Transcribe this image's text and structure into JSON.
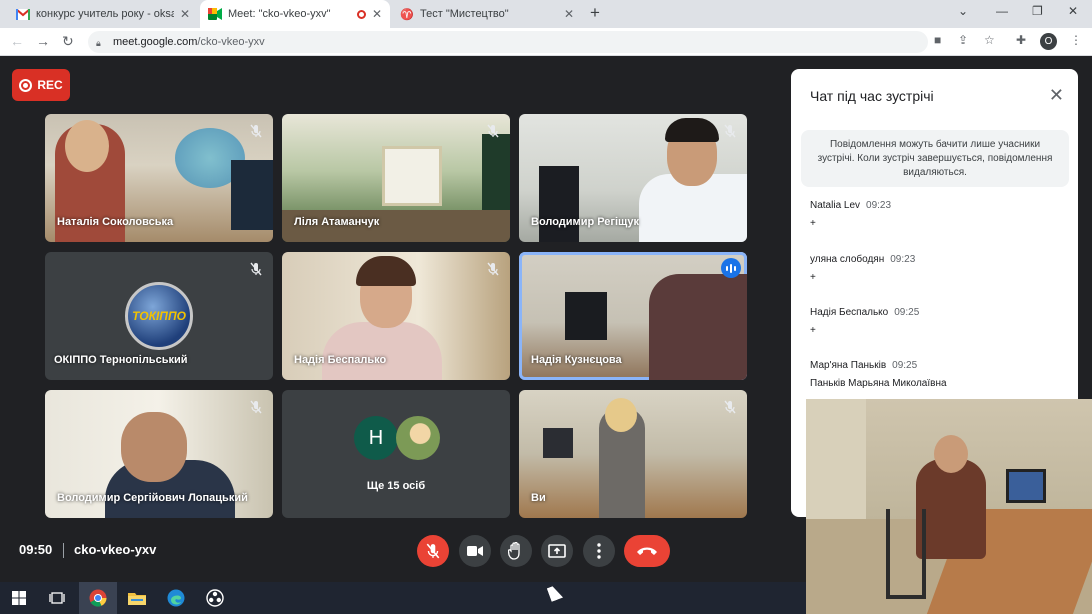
{
  "browser": {
    "tabs": [
      {
        "label": "конкурс учитель року - oksana.c",
        "favicon": "gmail-icon",
        "active": false
      },
      {
        "label": "Meet: \"cko-vkeo-yxv\"",
        "favicon": "meet-icon",
        "active": true,
        "recording": true
      },
      {
        "label": "Тест \"Мистецтво\"",
        "favicon": "test-icon",
        "active": false
      }
    ],
    "url_host": "meet.google.com",
    "url_path": "/cko-vkeo-yxv",
    "profile_initial": "O"
  },
  "meet": {
    "rec_label": "REC",
    "participants": [
      {
        "name": "Наталія Соколовська",
        "muted": true,
        "scene": "classroom-mural"
      },
      {
        "name": "Ліля Атаманчук",
        "muted": true,
        "scene": "classroom-green"
      },
      {
        "name": "Володимир Регіщук",
        "muted": true,
        "scene": "man-desk"
      },
      {
        "name": "ОКІППО Тернопільський",
        "muted": true,
        "scene": "logo",
        "logo_text": "ТОКІППО"
      },
      {
        "name": "Надія Беспалько",
        "muted": true,
        "scene": "woman-close"
      },
      {
        "name": "Надія Кузнєцова",
        "muted": false,
        "speaking": true,
        "scene": "computer-lab"
      },
      {
        "name": "Володимир Сергійович Лопацький",
        "muted": true,
        "scene": "man-window"
      },
      {
        "name": "Ще 15 осіб",
        "muted": false,
        "scene": "more",
        "avatar_letter": "Н"
      },
      {
        "name": "Ви",
        "muted": true,
        "scene": "you-desk"
      }
    ],
    "clock": "09:50",
    "meeting_code": "cko-vkeo-yxv",
    "controls": [
      "mic-off-icon",
      "camera-icon",
      "raise-hand-icon",
      "present-icon",
      "more-icon",
      "end-call-icon"
    ]
  },
  "chat": {
    "title": "Чат під час зустрічі",
    "notice": "Повідомлення можуть бачити лише учасники зустрічі. Коли зустріч завершується, повідомлення видаляються.",
    "messages": [
      {
        "author": "Natalia Lev",
        "time": "09:23",
        "text": "+"
      },
      {
        "author": "уляна слободян",
        "time": "09:23",
        "text": "+"
      },
      {
        "author": "Надія Беспалько",
        "time": "09:25",
        "text": "+"
      },
      {
        "author": "Мар'яна Паньків",
        "time": "09:25",
        "text": "Паньків Марьяна Миколаївна"
      }
    ]
  },
  "taskbar": {
    "items": [
      "windows-start-icon",
      "task-view-icon",
      "chrome-icon",
      "file-explorer-icon",
      "edge-icon",
      "obs-icon"
    ]
  },
  "colors": {
    "meet_bg": "#202124",
    "tile_bg": "#3c4043",
    "red": "#ea4335",
    "speaking_outline": "#8ab4f8"
  }
}
